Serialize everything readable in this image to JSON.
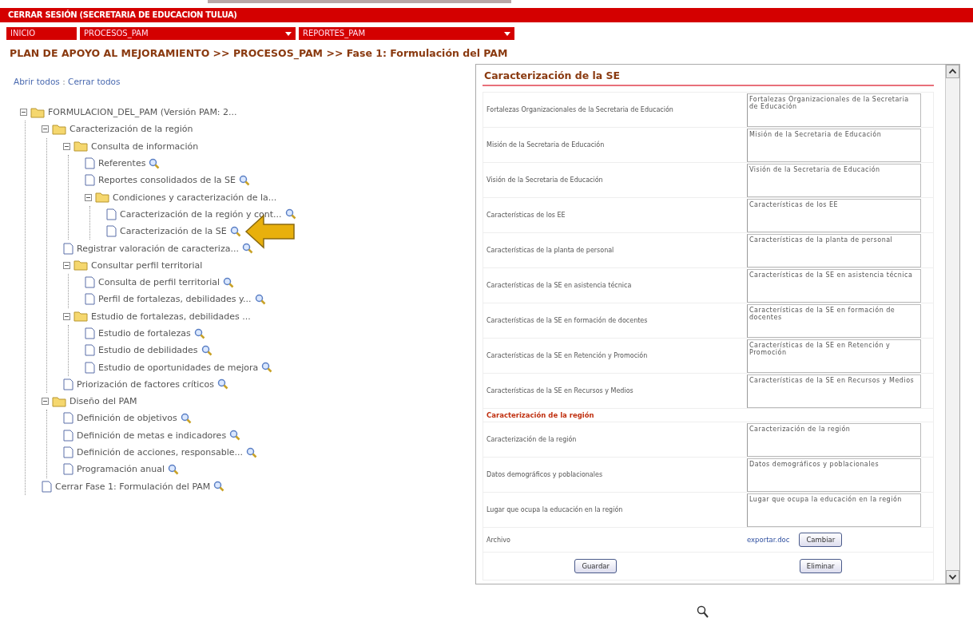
{
  "header": {
    "session": "CERRAR SESIÓN (SECRETARIA DE EDUCACION TULUA)"
  },
  "nav": [
    {
      "label": "INICIO",
      "dropdown": false
    },
    {
      "label": "PROCESOS_PAM",
      "dropdown": true
    },
    {
      "label": "REPORTES_PAM",
      "dropdown": true
    }
  ],
  "breadcrumb": "PLAN DE APOYO AL MEJORAMIENTO >> PROCESOS_PAM >> Fase 1: Formulación del PAM",
  "tree_links": [
    "Abrir todos",
    "Cerrar todos"
  ],
  "tree_separator": ":",
  "tree": [
    {
      "kind": "folder",
      "label": "FORMULACION_DEL_PAM (Versión PAM: 2...",
      "expanded": true,
      "children": [
        {
          "kind": "folder",
          "label": "Caracterización de la región",
          "expanded": true,
          "children": [
            {
              "kind": "folder",
              "label": "Consulta de información",
              "expanded": true,
              "children": [
                {
                  "kind": "doc",
                  "label": "Referentes",
                  "pointer": false
                },
                {
                  "kind": "doc",
                  "label": "Reportes consolidados de la SE",
                  "pointer": false
                },
                {
                  "kind": "folder",
                  "label": "Condiciones y caracterización de la...",
                  "expanded": true,
                  "children": [
                    {
                      "kind": "doc",
                      "label": "Caracterización de la región y cont...",
                      "pointer": false
                    },
                    {
                      "kind": "doc",
                      "label": "Caracterización de la SE",
                      "pointer": true
                    }
                  ]
                }
              ]
            },
            {
              "kind": "doc",
              "label": "Registrar valoración de caracteriza...",
              "pointer": false
            },
            {
              "kind": "folder",
              "label": "Consultar perfil territorial",
              "expanded": true,
              "children": [
                {
                  "kind": "doc",
                  "label": "Consulta de perfil territorial",
                  "pointer": false
                },
                {
                  "kind": "doc",
                  "label": "Perfil de fortalezas, debilidades y...",
                  "pointer": false
                }
              ]
            },
            {
              "kind": "folder",
              "label": "Estudio de fortalezas, debilidades ...",
              "expanded": true,
              "children": [
                {
                  "kind": "doc",
                  "label": "Estudio de fortalezas",
                  "pointer": false
                },
                {
                  "kind": "doc",
                  "label": "Estudio de debilidades",
                  "pointer": false
                },
                {
                  "kind": "doc",
                  "label": "Estudio de oportunidades de mejora",
                  "pointer": false
                }
              ]
            },
            {
              "kind": "doc",
              "label": "Priorización de factores críticos",
              "pointer": false
            }
          ]
        },
        {
          "kind": "folder",
          "label": "Diseño del PAM",
          "expanded": true,
          "children": [
            {
              "kind": "doc",
              "label": "Definición de objetivos",
              "pointer": false
            },
            {
              "kind": "doc",
              "label": "Definición de metas e indicadores",
              "pointer": false
            },
            {
              "kind": "doc",
              "label": "Definición de acciones, responsable...",
              "pointer": false
            },
            {
              "kind": "doc",
              "label": "Programación anual",
              "pointer": false
            }
          ]
        },
        {
          "kind": "doc",
          "label": "Cerrar Fase 1: Formulación del PAM",
          "pointer": false
        }
      ]
    }
  ],
  "form": {
    "title": "Caracterización de la SE",
    "rows": [
      {
        "kind": "field",
        "label": "Fortalezas Organizacionales de la Secretaria de Educación",
        "value": "Fortalezas Organizacionales de la Secretaria de Educación"
      },
      {
        "kind": "field",
        "label": "Misión de la Secretaria de Educación",
        "value": "Misión de la Secretaria de Educación"
      },
      {
        "kind": "field",
        "label": "Visión de la Secretaria de Educación",
        "value": "Visión de la Secretaria de Educación"
      },
      {
        "kind": "field",
        "label": "Características de los EE",
        "value": "Características de los EE"
      },
      {
        "kind": "field",
        "label": "Características de la planta de personal",
        "value": "Características de la planta de personal"
      },
      {
        "kind": "field",
        "label": "Características de la SE en asistencia técnica",
        "value": "Características de la SE en asistencia técnica"
      },
      {
        "kind": "field",
        "label": "Características de la SE en formación de docentes",
        "value": "Características de la SE en formación de docentes"
      },
      {
        "kind": "field",
        "label": "Características de la SE en Retención y Promoción",
        "value": "Características de la SE en Retención y Promoción"
      },
      {
        "kind": "field",
        "label": "Características de la SE en Recursos y Medios",
        "value": "Características de la SE en Recursos y Medios"
      },
      {
        "kind": "section",
        "label": "Caracterización de la región"
      },
      {
        "kind": "field",
        "label": "Caracterización de la región",
        "value": "Caracterización de la región"
      },
      {
        "kind": "field",
        "label": "Datos demográficos y poblacionales",
        "value": "Datos demográficos y poblacionales"
      },
      {
        "kind": "field",
        "label": "Lugar que ocupa la educación en la región",
        "value": "Lugar que ocupa la educación en la región"
      },
      {
        "kind": "file",
        "label": "Archivo",
        "link": "exportar.doc",
        "button": "Cambiar"
      }
    ],
    "buttons": [
      "Guardar",
      "Eliminar"
    ]
  }
}
